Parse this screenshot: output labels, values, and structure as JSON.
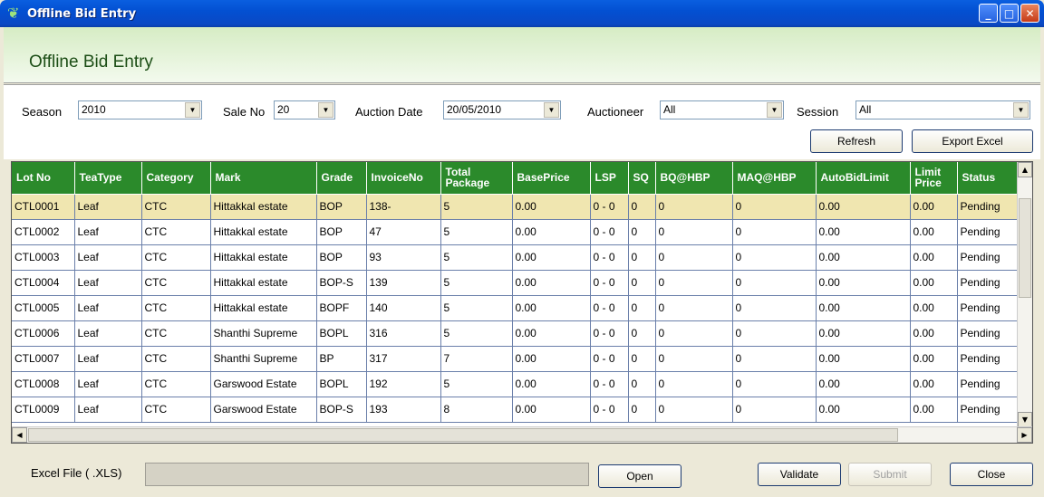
{
  "window": {
    "title": "Offline Bid Entry"
  },
  "header": {
    "title": "Offline Bid Entry"
  },
  "filters": {
    "season_label": "Season",
    "season_value": "2010",
    "sale_label": "Sale No",
    "sale_value": "20",
    "date_label": "Auction Date",
    "date_value": "20/05/2010",
    "auctioneer_label": "Auctioneer",
    "auctioneer_value": "All",
    "session_label": "Session",
    "session_value": "All",
    "refresh_label": "Refresh",
    "export_label": "Export Excel"
  },
  "grid": {
    "columns": [
      "Lot No",
      "TeaType",
      "Category",
      "Mark",
      "Grade",
      "InvoiceNo",
      "Total Package",
      "BasePrice",
      "LSP",
      "SQ",
      "BQ@HBP",
      "MAQ@HBP",
      "AutoBidLimit",
      "Limit Price",
      "Status"
    ],
    "rows": [
      [
        "CTL0001",
        "Leaf",
        "CTC",
        "Hittakkal estate",
        "BOP",
        "138-",
        "5",
        "0.00",
        "0 - 0",
        "0",
        "0",
        "0",
        "0.00",
        "0.00",
        "Pending"
      ],
      [
        "CTL0002",
        "Leaf",
        "CTC",
        "Hittakkal estate",
        "BOP",
        "47",
        "5",
        "0.00",
        "0 - 0",
        "0",
        "0",
        "0",
        "0.00",
        "0.00",
        "Pending"
      ],
      [
        "CTL0003",
        "Leaf",
        "CTC",
        "Hittakkal estate",
        "BOP",
        "93",
        "5",
        "0.00",
        "0 - 0",
        "0",
        "0",
        "0",
        "0.00",
        "0.00",
        "Pending"
      ],
      [
        "CTL0004",
        "Leaf",
        "CTC",
        "Hittakkal estate",
        "BOP-S",
        "139",
        "5",
        "0.00",
        "0 - 0",
        "0",
        "0",
        "0",
        "0.00",
        "0.00",
        "Pending"
      ],
      [
        "CTL0005",
        "Leaf",
        "CTC",
        "Hittakkal estate",
        "BOPF",
        "140",
        "5",
        "0.00",
        "0 - 0",
        "0",
        "0",
        "0",
        "0.00",
        "0.00",
        "Pending"
      ],
      [
        "CTL0006",
        "Leaf",
        "CTC",
        "Shanthi Supreme",
        "BOPL",
        "316",
        "5",
        "0.00",
        "0 - 0",
        "0",
        "0",
        "0",
        "0.00",
        "0.00",
        "Pending"
      ],
      [
        "CTL0007",
        "Leaf",
        "CTC",
        "Shanthi Supreme",
        "BP",
        "317",
        "7",
        "0.00",
        "0 - 0",
        "0",
        "0",
        "0",
        "0.00",
        "0.00",
        "Pending"
      ],
      [
        "CTL0008",
        "Leaf",
        "CTC",
        "Garswood Estate",
        "BOPL",
        "192",
        "5",
        "0.00",
        "0 - 0",
        "0",
        "0",
        "0",
        "0.00",
        "0.00",
        "Pending"
      ],
      [
        "CTL0009",
        "Leaf",
        "CTC",
        "Garswood Estate",
        "BOP-S",
        "193",
        "8",
        "0.00",
        "0 - 0",
        "0",
        "0",
        "0",
        "0.00",
        "0.00",
        "Pending"
      ]
    ]
  },
  "footer": {
    "file_label": "Excel File ( .XLS)",
    "open_label": "Open",
    "validate_label": "Validate",
    "submit_label": "Submit",
    "close_label": "Close"
  },
  "colors": {
    "header_green": "#2b8a2b",
    "selected_row": "#f0e6b0",
    "titlebar_blue": "#0350d2"
  }
}
